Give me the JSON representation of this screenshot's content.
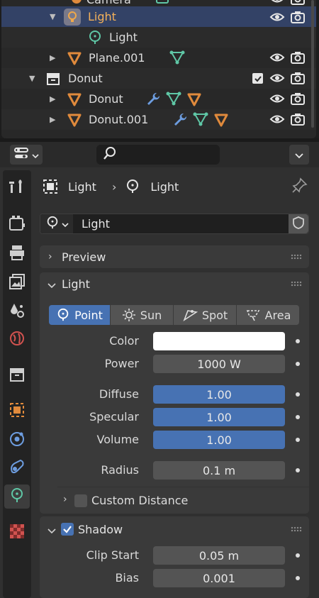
{
  "outliner": {
    "top_partial_label": "Camera",
    "rows": [
      {
        "label": "Light",
        "selected": true
      },
      {
        "label": "Light"
      },
      {
        "label": "Plane.001"
      },
      {
        "label": "Donut"
      },
      {
        "label": "Donut"
      },
      {
        "label": "Donut.001"
      }
    ]
  },
  "header": {
    "editor_icon": "properties-editor-icon",
    "search_placeholder": "",
    "options_icon": "chevron-down-icon"
  },
  "breadcrumb": {
    "object": "Light",
    "data": "Light"
  },
  "datablock": {
    "name": "Light"
  },
  "panels": {
    "preview": {
      "title": "Preview",
      "expanded": false
    },
    "light": {
      "title": "Light",
      "expanded": true,
      "types": [
        {
          "label": "Point",
          "selected": true
        },
        {
          "label": "Sun"
        },
        {
          "label": "Spot"
        },
        {
          "label": "Area"
        }
      ],
      "color_label": "Color",
      "color_value": "#ffffff",
      "power_label": "Power",
      "power_value": "1000 W",
      "diffuse_label": "Diffuse",
      "diffuse_value": "1.00",
      "specular_label": "Specular",
      "specular_value": "1.00",
      "volume_label": "Volume",
      "volume_value": "1.00",
      "radius_label": "Radius",
      "radius_value": "0.1 m",
      "custom_distance_label": "Custom Distance"
    },
    "shadow": {
      "title": "Shadow",
      "enabled": true,
      "clip_start_label": "Clip Start",
      "clip_start_value": "0.05 m",
      "bias_label": "Bias",
      "bias_value": "0.001"
    }
  },
  "colors": {
    "accent": "#4772b3",
    "selected_row": "#334266",
    "object_orange": "#e08a3c",
    "data_green": "#5fc7a6",
    "modifier_blue": "#6d9de0"
  }
}
